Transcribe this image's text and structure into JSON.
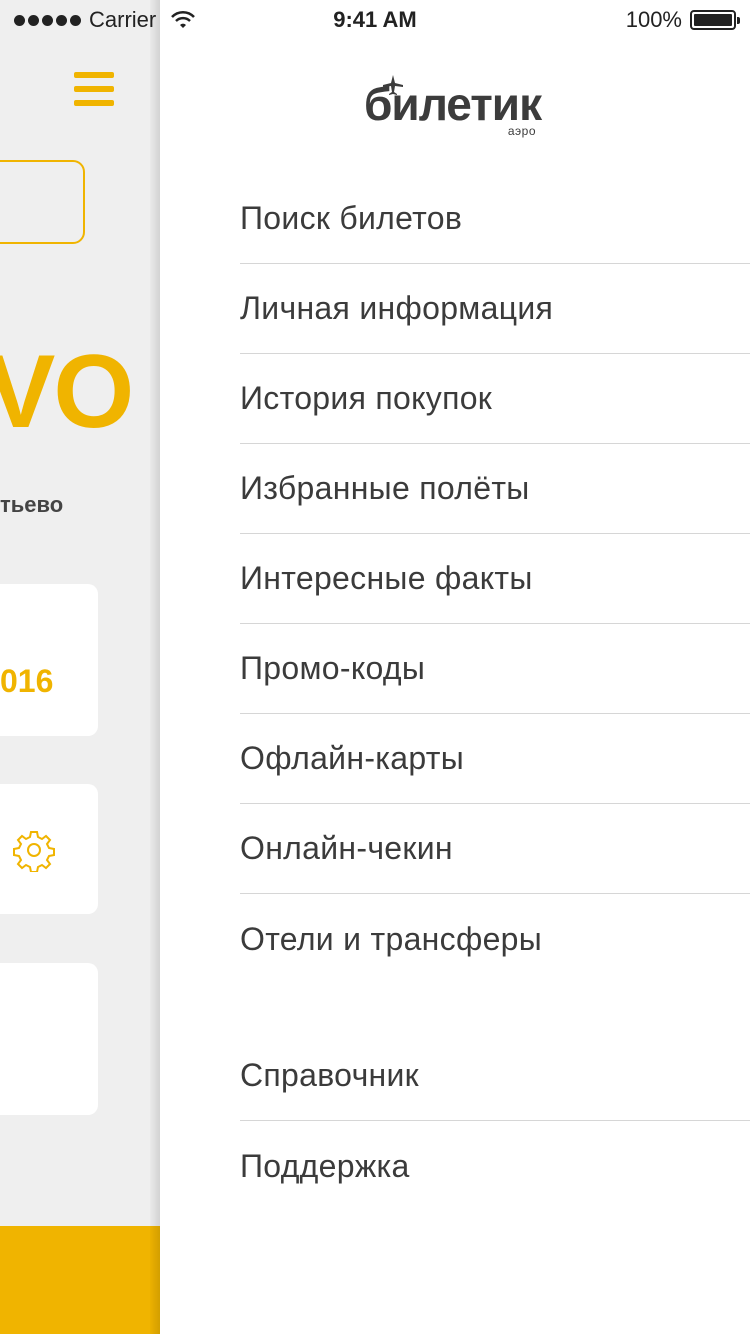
{
  "status_bar": {
    "carrier": "Carrier",
    "time": "9:41 AM",
    "battery": "100%"
  },
  "background_screen": {
    "airport_code_fragment": "VO",
    "city_fragment": "тьево",
    "date_fragment": "016",
    "accent_color": "#f0b400",
    "icons": [
      "hamburger-icon",
      "gear-icon"
    ]
  },
  "drawer": {
    "logo": {
      "title": "билетик",
      "subtitle": "аэро"
    },
    "menu_primary": [
      "Поиск билетов",
      "Личная информация",
      "История покупок",
      "Избранные полёты",
      "Интересные факты",
      "Промо-коды",
      "Офлайн-карты",
      "Онлайн-чекин",
      "Отели и трансферы"
    ],
    "menu_secondary": [
      "Справочник",
      "Поддержка"
    ]
  }
}
